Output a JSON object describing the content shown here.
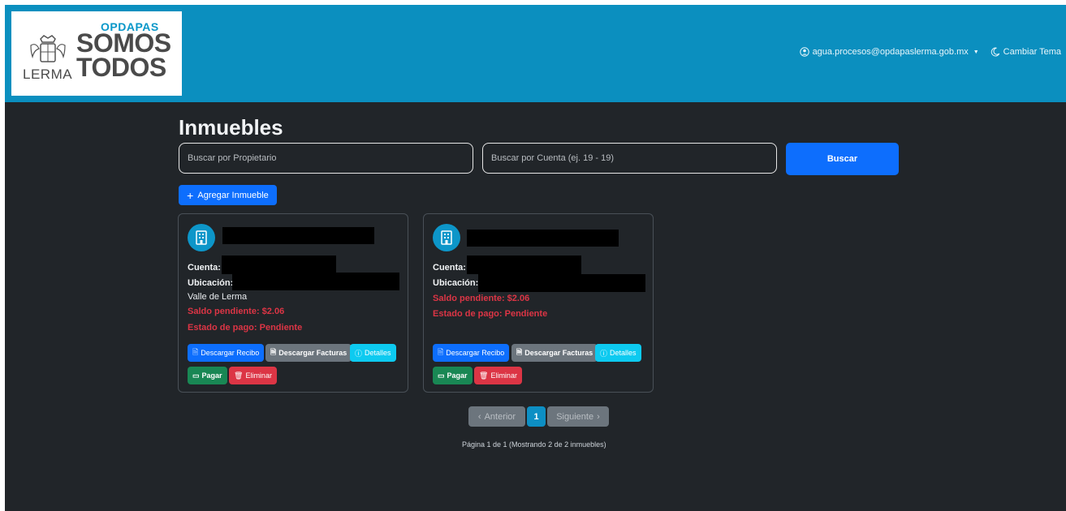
{
  "brand": {
    "top": "OPDAPAS",
    "line1": "SOMOS",
    "line2": "TODOS",
    "city": "LERMA"
  },
  "nav": {
    "user": "agua.procesos@opdapaslerma.gob.mx",
    "theme": "Cambiar Tema"
  },
  "page": {
    "title": "Inmuebles",
    "search_owner_placeholder": "Buscar por Propietario",
    "search_account_placeholder": "Buscar por Cuenta (ej. 19 - 19)",
    "search_button": "Buscar",
    "add_button": "Agregar Inmueble"
  },
  "cards": [
    {
      "cuenta_label": "Cuenta:",
      "ubicacion_label": "Ubicación:",
      "ubicacion_extra": "Valle de Lerma",
      "saldo": "Saldo pendiente: $2.06",
      "estado": "Estado de pago: Pendiente",
      "btn_recibo": "Descargar Recibo",
      "btn_facturas": "Descargar Facturas",
      "btn_detalles": "Detalles",
      "btn_pagar": "Pagar",
      "btn_eliminar": "Eliminar"
    },
    {
      "cuenta_label": "Cuenta:",
      "ubicacion_label": "Ubicación:",
      "saldo": "Saldo pendiente: $2.06",
      "estado": "Estado de pago: Pendiente",
      "btn_recibo": "Descargar Recibo",
      "btn_facturas": "Descargar Facturas",
      "btn_detalles": "Detalles",
      "btn_pagar": "Pagar",
      "btn_eliminar": "Eliminar"
    }
  ],
  "pagination": {
    "prev": "Anterior",
    "current": "1",
    "next": "Siguiente",
    "info": "Página 1 de 1 (Mostrando 2 de 2 inmuebles)"
  },
  "colors": {
    "navbar": "#0b8fbf",
    "background": "#212529",
    "primary": "#0d6efd",
    "danger": "#dc3545",
    "success": "#198754",
    "info": "#0dcaf0"
  }
}
